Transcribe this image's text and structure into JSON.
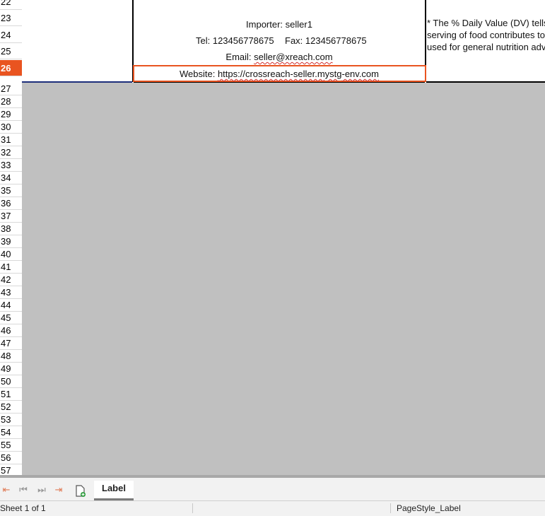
{
  "rows": [
    "22",
    "23",
    "24",
    "25",
    "26",
    "27",
    "28",
    "29",
    "30",
    "31",
    "32",
    "33",
    "34",
    "35",
    "36",
    "37",
    "38",
    "39",
    "40",
    "41",
    "42",
    "43",
    "44",
    "45",
    "46",
    "47",
    "48",
    "49",
    "50",
    "51",
    "52",
    "53",
    "54",
    "55",
    "56",
    "57"
  ],
  "active_row": "26",
  "cells": {
    "importer": "Importer: seller1",
    "tel": "Tel: 123456778675",
    "fax": "Fax: 123456778675",
    "email_label": "Email: ",
    "email_value": "seller@xreach.com",
    "website_label": "Website: ",
    "website_value": "https://crossreach-seller.mystg-env.com",
    "dv_line1": "* The % Daily Value (DV) tells y",
    "dv_line2": "serving of food contributes to a",
    "dv_line3": "used for general nutrition advic"
  },
  "sheet_tabs": [
    {
      "label": "Label",
      "active": true
    }
  ],
  "nav_icons": [
    "first-sheet-icon",
    "prev-sheet-icon",
    "next-sheet-icon",
    "last-sheet-icon",
    "add-sheet-icon"
  ],
  "status": {
    "sheet_position": "Sheet 1 of 1",
    "page_style": "PageStyle_Label"
  },
  "colors": {
    "accent": "#e95420",
    "gray_area": "#c0c0c0"
  }
}
